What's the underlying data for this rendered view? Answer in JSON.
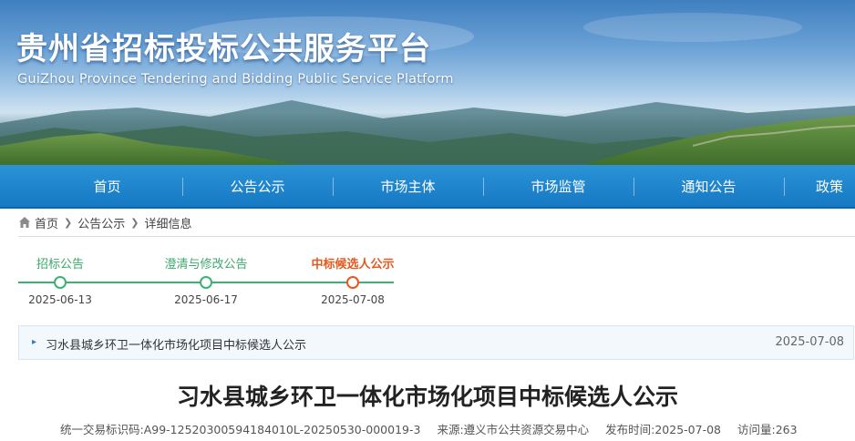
{
  "site": {
    "title": "贵州省招标投标公共服务平台",
    "subtitle": "GuiZhou Province Tendering and Bidding Public Service Platform"
  },
  "nav": {
    "items": [
      {
        "label": "首页"
      },
      {
        "label": "公告公示"
      },
      {
        "label": "市场主体"
      },
      {
        "label": "市场监管"
      },
      {
        "label": "通知公告"
      },
      {
        "label": "政策"
      }
    ]
  },
  "breadcrumb": {
    "home": "首页",
    "level1": "公告公示",
    "level2": "详细信息"
  },
  "timeline": {
    "steps": [
      {
        "label": "招标公告",
        "date": "2025-06-13",
        "active": false
      },
      {
        "label": "澄清与修改公告",
        "date": "2025-06-17",
        "active": false
      },
      {
        "label": "中标候选人公示",
        "date": "2025-07-08",
        "active": true
      }
    ]
  },
  "notice": {
    "title": "习水县城乡环卫一体化市场化项目中标候选人公示",
    "date": "2025-07-08"
  },
  "article": {
    "title": "习水县城乡环卫一体化市场化项目中标候选人公示",
    "meta": {
      "code": "统一交易标识码:A99-12520300594184010L-20250530-000019-3",
      "source": "来源:遵义市公共资源交易中心",
      "publish": "发布时间:2025-07-08",
      "views": "访问量:263"
    }
  },
  "colors": {
    "nav_bg": "#1a7fc8",
    "timeline_green": "#3bb374",
    "timeline_active": "#e6581e"
  }
}
